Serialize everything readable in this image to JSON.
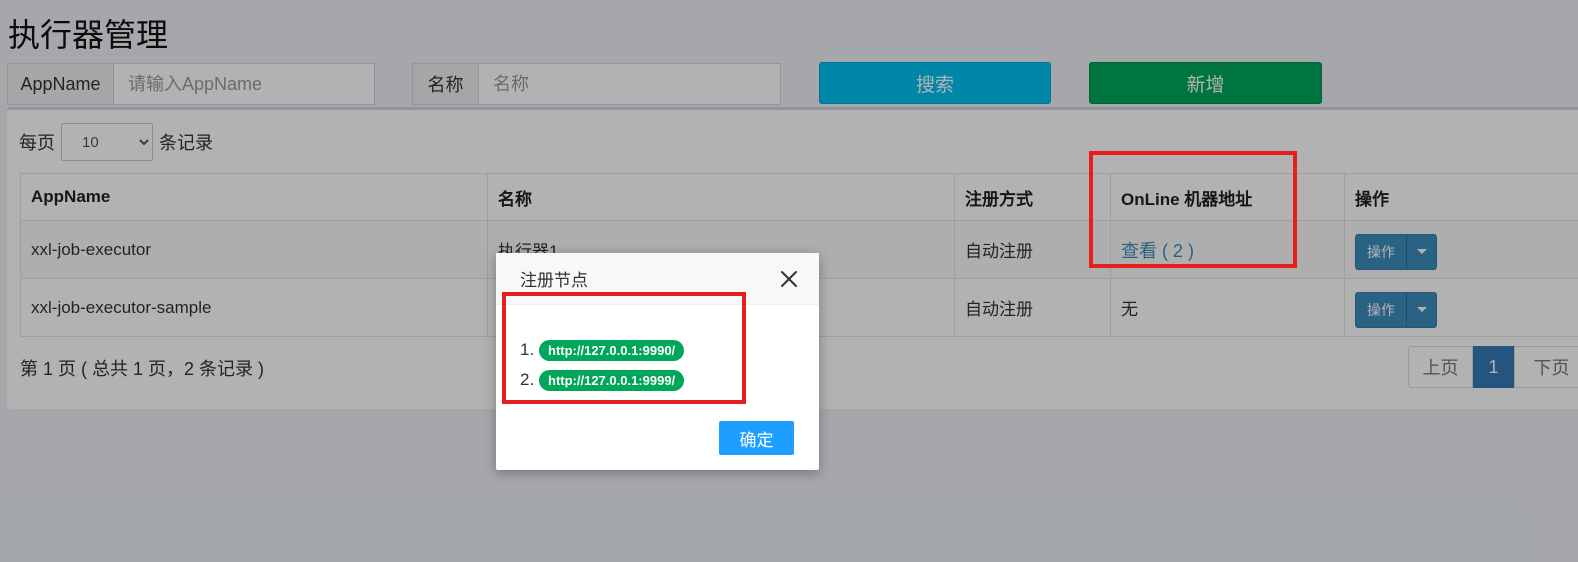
{
  "page": {
    "title": "执行器管理"
  },
  "search": {
    "appname_label": "AppName",
    "appname_placeholder": "请输入AppName",
    "name_label": "名称",
    "name_placeholder": "名称",
    "search_button": "搜索",
    "add_button": "新增"
  },
  "table_controls": {
    "per_page_prefix": "每页",
    "per_page_value": "10",
    "per_page_suffix": "条记录"
  },
  "table": {
    "headers": [
      "AppName",
      "名称",
      "注册方式",
      "OnLine 机器地址",
      "操作"
    ],
    "rows": [
      {
        "appname": "xxl-job-executor",
        "name": "执行器1",
        "reg_type": "自动注册",
        "online": "查看 ( 2 )",
        "action": "操作"
      },
      {
        "appname": "xxl-job-executor-sample",
        "name": "",
        "reg_type": "自动注册",
        "online": "无",
        "action": "操作"
      }
    ]
  },
  "footer": {
    "info": "第 1 页 ( 总共 1 页，2 条记录 )",
    "prev": "上页",
    "current": "1",
    "next": "下页"
  },
  "modal": {
    "title": "注册节点",
    "nodes": [
      {
        "index": "1.",
        "address": "http://127.0.0.1:9990/"
      },
      {
        "index": "2.",
        "address": "http://127.0.0.1:9999/"
      }
    ],
    "ok_button": "确定"
  },
  "colors": {
    "search_button": "#00c0ef",
    "add_button": "#00a65a",
    "highlight": "#e61e1e",
    "badge": "#00a65a",
    "primary": "#3c8dbc"
  },
  "icons": {
    "modal_close": "close-icon",
    "dropdown": "chevron-down-icon"
  }
}
